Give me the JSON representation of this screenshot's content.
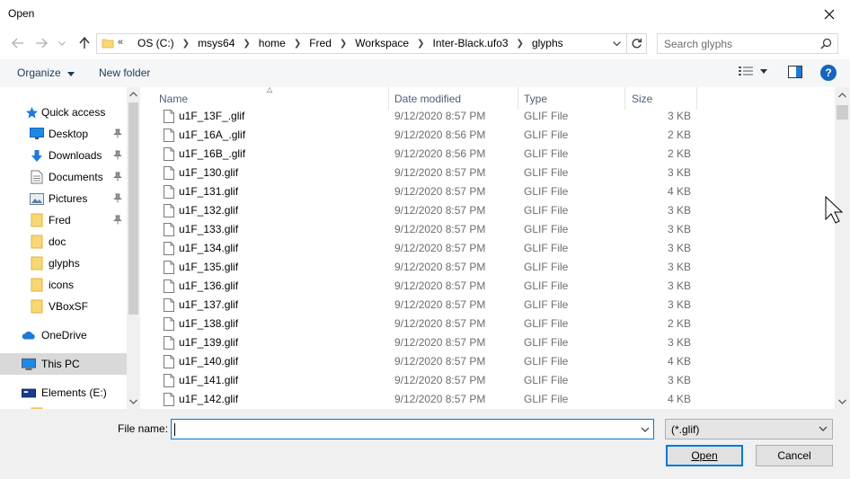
{
  "window": {
    "title": "Open"
  },
  "address": {
    "overflow": "«",
    "crumbs": [
      "OS (C:)",
      "msys64",
      "home",
      "Fred",
      "Workspace",
      "Inter-Black.ufo3",
      "glyphs"
    ]
  },
  "search": {
    "placeholder": "Search glyphs"
  },
  "toolbar": {
    "organize": "Organize",
    "new_folder": "New folder"
  },
  "nav": {
    "quick_access": "Quick access",
    "items": [
      {
        "label": "Desktop",
        "icon": "desktop-icon",
        "pinned": true
      },
      {
        "label": "Downloads",
        "icon": "download-icon",
        "pinned": true
      },
      {
        "label": "Documents",
        "icon": "document-icon",
        "pinned": true
      },
      {
        "label": "Pictures",
        "icon": "pictures-icon",
        "pinned": true
      },
      {
        "label": "Fred",
        "icon": "folder-icon",
        "pinned": true
      },
      {
        "label": "doc",
        "icon": "folder-icon",
        "pinned": false
      },
      {
        "label": "glyphs",
        "icon": "folder-icon",
        "pinned": false
      },
      {
        "label": "icons",
        "icon": "folder-icon",
        "pinned": false
      },
      {
        "label": "VBoxSF",
        "icon": "folder-icon",
        "pinned": false
      }
    ],
    "onedrive": "OneDrive",
    "this_pc": "This PC",
    "elements": "Elements (E:)"
  },
  "columns": {
    "name": "Name",
    "date": "Date modified",
    "type": "Type",
    "size": "Size"
  },
  "files": [
    {
      "name": "u1F_13F_.glif",
      "date": "9/12/2020 8:57 PM",
      "type": "GLIF File",
      "size": "3 KB"
    },
    {
      "name": "u1F_16A_.glif",
      "date": "9/12/2020 8:56 PM",
      "type": "GLIF File",
      "size": "2 KB"
    },
    {
      "name": "u1F_16B_.glif",
      "date": "9/12/2020 8:56 PM",
      "type": "GLIF File",
      "size": "2 KB"
    },
    {
      "name": "u1F_130.glif",
      "date": "9/12/2020 8:57 PM",
      "type": "GLIF File",
      "size": "3 KB"
    },
    {
      "name": "u1F_131.glif",
      "date": "9/12/2020 8:57 PM",
      "type": "GLIF File",
      "size": "4 KB"
    },
    {
      "name": "u1F_132.glif",
      "date": "9/12/2020 8:57 PM",
      "type": "GLIF File",
      "size": "3 KB"
    },
    {
      "name": "u1F_133.glif",
      "date": "9/12/2020 8:57 PM",
      "type": "GLIF File",
      "size": "3 KB"
    },
    {
      "name": "u1F_134.glif",
      "date": "9/12/2020 8:57 PM",
      "type": "GLIF File",
      "size": "3 KB"
    },
    {
      "name": "u1F_135.glif",
      "date": "9/12/2020 8:57 PM",
      "type": "GLIF File",
      "size": "3 KB"
    },
    {
      "name": "u1F_136.glif",
      "date": "9/12/2020 8:57 PM",
      "type": "GLIF File",
      "size": "3 KB"
    },
    {
      "name": "u1F_137.glif",
      "date": "9/12/2020 8:57 PM",
      "type": "GLIF File",
      "size": "3 KB"
    },
    {
      "name": "u1F_138.glif",
      "date": "9/12/2020 8:57 PM",
      "type": "GLIF File",
      "size": "2 KB"
    },
    {
      "name": "u1F_139.glif",
      "date": "9/12/2020 8:57 PM",
      "type": "GLIF File",
      "size": "3 KB"
    },
    {
      "name": "u1F_140.glif",
      "date": "9/12/2020 8:57 PM",
      "type": "GLIF File",
      "size": "4 KB"
    },
    {
      "name": "u1F_141.glif",
      "date": "9/12/2020 8:57 PM",
      "type": "GLIF File",
      "size": "3 KB"
    },
    {
      "name": "u1F_142.glif",
      "date": "9/12/2020 8:57 PM",
      "type": "GLIF File",
      "size": "4 KB"
    }
  ],
  "bottom": {
    "file_name_label": "File name:",
    "file_name_value": "",
    "filter": "(*.glif)",
    "open": "Open",
    "cancel": "Cancel"
  },
  "colors": {
    "accent": "#0078d7",
    "link": "#1e395b",
    "help": "#1565c0",
    "folder": "#f8d775"
  }
}
